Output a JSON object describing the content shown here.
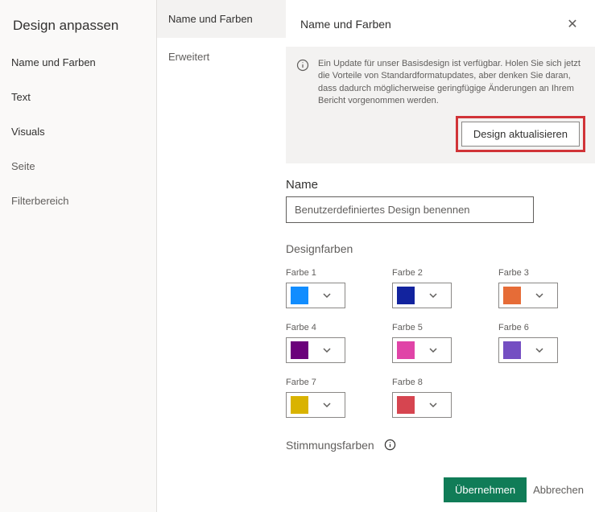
{
  "left": {
    "title": "Design anpassen",
    "items": [
      {
        "label": "Name und Farben"
      },
      {
        "label": "Text"
      },
      {
        "label": "Visuals"
      },
      {
        "label": "Seite"
      },
      {
        "label": "Filterbereich"
      }
    ]
  },
  "middle": {
    "items": [
      {
        "label": "Name und Farben"
      },
      {
        "label": "Erweitert"
      }
    ]
  },
  "panel": {
    "title": "Name und Farben",
    "info_text": "Ein Update für unser Basisdesign ist verfügbar. Holen Sie sich jetzt die Vorteile von Standardformatupdates, aber denken Sie daran, dass dadurch möglicherweise geringfügige Änderungen an Ihrem Bericht vorgenommen werden.",
    "update_button": "Design aktualisieren",
    "name_label": "Name",
    "name_placeholder": "Benutzerdefiniertes Design benennen",
    "design_colors_title": "Designfarben",
    "colors": [
      {
        "label": "Farbe 1",
        "hex": "#118dff"
      },
      {
        "label": "Farbe 2",
        "hex": "#12239e"
      },
      {
        "label": "Farbe 3",
        "hex": "#e66c37"
      },
      {
        "label": "Farbe 4",
        "hex": "#6b007b"
      },
      {
        "label": "Farbe 5",
        "hex": "#e044a7"
      },
      {
        "label": "Farbe 6",
        "hex": "#744ec2"
      },
      {
        "label": "Farbe 7",
        "hex": "#d9b300"
      },
      {
        "label": "Farbe 8",
        "hex": "#d64550"
      }
    ],
    "mood_colors_title": "Stimmungsfarben"
  },
  "footer": {
    "apply": "Übernehmen",
    "cancel": "Abbrechen"
  }
}
